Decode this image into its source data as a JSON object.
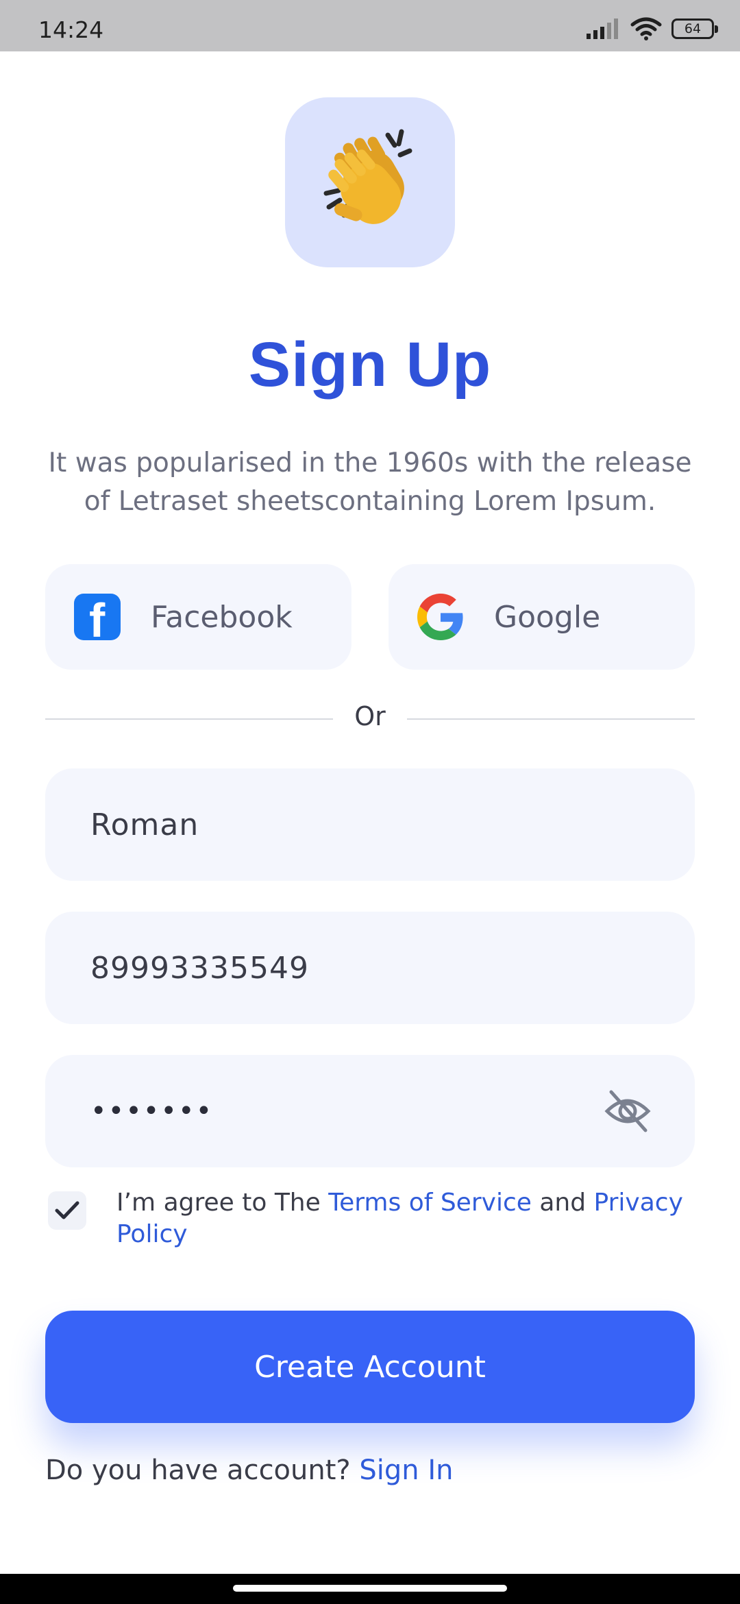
{
  "status_bar": {
    "time": "14:24",
    "battery": "64"
  },
  "hero": {
    "icon": "clapping-hands-icon"
  },
  "title": "Sign Up",
  "subtitle": "It was popularised in the 1960s with the release of Letraset sheetscontaining Lorem Ipsum.",
  "social": {
    "facebook_label": "Facebook",
    "google_label": "Google"
  },
  "divider_label": "Or",
  "form": {
    "name_value": "Roman",
    "phone_value": "89993335549",
    "password_masked": "•••••••"
  },
  "terms": {
    "prefix": "I’m agree to The",
    "tos_link": "Terms of Service",
    "and": "and",
    "privacy_link": "Privacy Policy",
    "checked": true
  },
  "create_button_label": "Create Account",
  "signin": {
    "prompt": "Do you have account?",
    "link": "Sign In"
  },
  "colors": {
    "accent": "#3863f7",
    "title": "#2f52d9",
    "field_bg": "#f4f6fd",
    "hero_bg": "#dbe2fd"
  }
}
